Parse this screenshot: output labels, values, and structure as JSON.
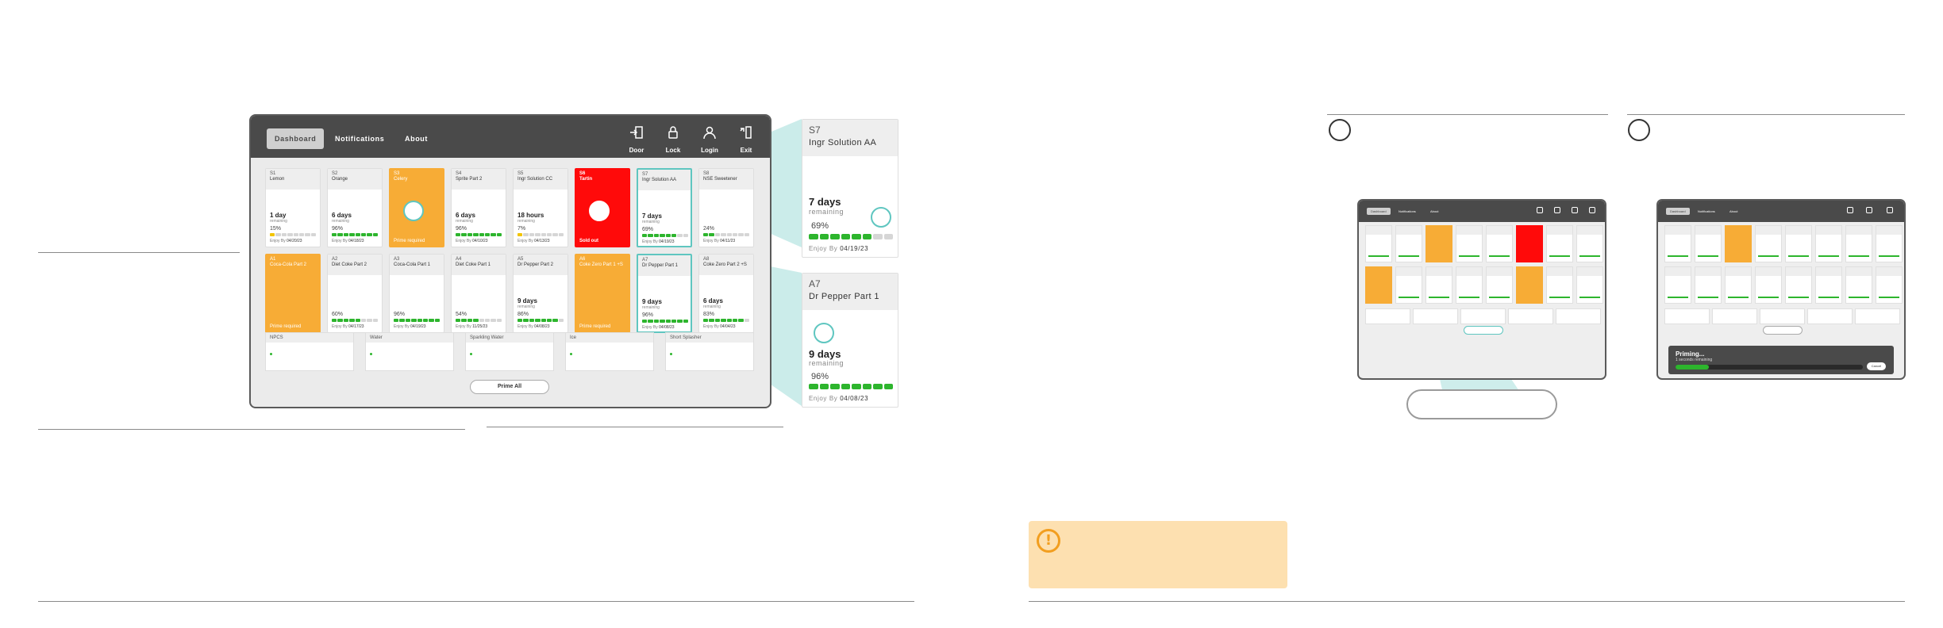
{
  "nav": {
    "tabs": [
      "Dashboard",
      "Notifications",
      "About"
    ],
    "active": "Dashboard",
    "buttons": [
      {
        "label": "Door",
        "icon": "door-exit-icon"
      },
      {
        "label": "Lock",
        "icon": "lock-icon"
      },
      {
        "label": "Login",
        "icon": "user-icon"
      },
      {
        "label": "Exit",
        "icon": "exit-icon"
      }
    ]
  },
  "slots": {
    "S1": {
      "slot": "S1",
      "name": "Lemon",
      "big": "1 day",
      "remaining": "remaining",
      "pct": "15%",
      "enjoy_label": "Enjoy By",
      "date": "04/20/23",
      "level": 0.15
    },
    "S2": {
      "slot": "S2",
      "name": "Orange",
      "big": "6 days",
      "remaining": "remaining",
      "pct": "96%",
      "enjoy_label": "Enjoy By",
      "date": "04/18/23",
      "level": 0.96
    },
    "S3": {
      "slot": "S3",
      "name": "Celery",
      "warn": "Prime required"
    },
    "S4": {
      "slot": "S4",
      "name": "Sprite Part 2",
      "big": "6 days",
      "remaining": "remaining",
      "pct": "96%",
      "enjoy_label": "Enjoy By",
      "date": "04/10/23",
      "level": 0.96
    },
    "S5": {
      "slot": "S5",
      "name": "Ingr Solution CC",
      "big": "18 hours",
      "remaining": "remaining",
      "pct": "7%",
      "enjoy_label": "Enjoy By",
      "date": "04/13/23",
      "level": 0.07
    },
    "S6": {
      "slot": "S6",
      "name": "Tartin",
      "warn": "Sold out"
    },
    "S7": {
      "slot": "S7",
      "name": "Ingr Solution AA",
      "big": "7 days",
      "remaining": "remaining",
      "pct": "69%",
      "enjoy_label": "Enjoy By",
      "date": "04/19/23",
      "level": 0.69
    },
    "S8": {
      "slot": "S8",
      "name": "NSE Sweetener",
      "pct": "24%",
      "enjoy_label": "Enjoy By",
      "date": "04/11/23",
      "level": 0.24
    },
    "A1": {
      "slot": "A1",
      "name": "Coca-Cola Part 2",
      "warn": "Prime required"
    },
    "A2": {
      "slot": "A2",
      "name": "Diet Coke Part 2",
      "pct": "60%",
      "enjoy_label": "Enjoy By",
      "date": "04/17/23",
      "level": 0.6
    },
    "A3": {
      "slot": "A3",
      "name": "Coca-Cola Part 1",
      "pct": "96%",
      "enjoy_label": "Enjoy By",
      "date": "04/19/23",
      "level": 0.96
    },
    "A4": {
      "slot": "A4",
      "name": "Diet Coke Part 1",
      "pct": "54%",
      "enjoy_label": "Enjoy By",
      "date": "11/25/23",
      "level": 0.54
    },
    "A5": {
      "slot": "A5",
      "name": "Dr Pepper Part 2",
      "big": "9 days",
      "remaining": "remaining",
      "pct": "86%",
      "enjoy_label": "Enjoy By",
      "date": "04/08/23",
      "level": 0.86
    },
    "A6": {
      "slot": "A6",
      "name": "Coke Zero Part 1 +S",
      "warn": "Prime required"
    },
    "A7": {
      "slot": "A7",
      "name": "Dr Pepper Part 1",
      "big": "9 days",
      "remaining": "remaining",
      "pct": "96%",
      "enjoy_label": "Enjoy By",
      "date": "04/08/23",
      "level": 0.96
    },
    "A8": {
      "slot": "A8",
      "name": "Coke Zero Part 2 +S",
      "big": "6 days",
      "remaining": "remaining",
      "pct": "83%",
      "enjoy_label": "Enjoy By",
      "date": "04/04/23",
      "level": 0.83
    }
  },
  "water": [
    "NPCS",
    "Water",
    "Sparkling Water",
    "Ice",
    "Short Splasher"
  ],
  "prime_all": "Prime All",
  "zoom_s7": {
    "slot": "S7",
    "name": "Ingr Solution AA",
    "big": "7 days",
    "remaining": "remaining",
    "pct": "69%",
    "enjoy_label": "Enjoy By",
    "date": "04/19/23",
    "level": 0.69
  },
  "zoom_a7": {
    "slot": "A7",
    "name": "Dr Pepper Part 1",
    "big": "9 days",
    "remaining": "remaining",
    "pct": "96%",
    "enjoy_label": "Enjoy By",
    "date": "04/08/23",
    "level": 0.96
  },
  "dialog": {
    "title": "Priming...",
    "subtitle": "1 seconds remaining",
    "cancel": "Cancel",
    "progress": 0.18
  },
  "warning_glyph": "!",
  "colors": {
    "accent": "#5fc6c0",
    "warning": "#f7ac36",
    "error": "#ff0a0a",
    "ok": "#2db52d"
  }
}
